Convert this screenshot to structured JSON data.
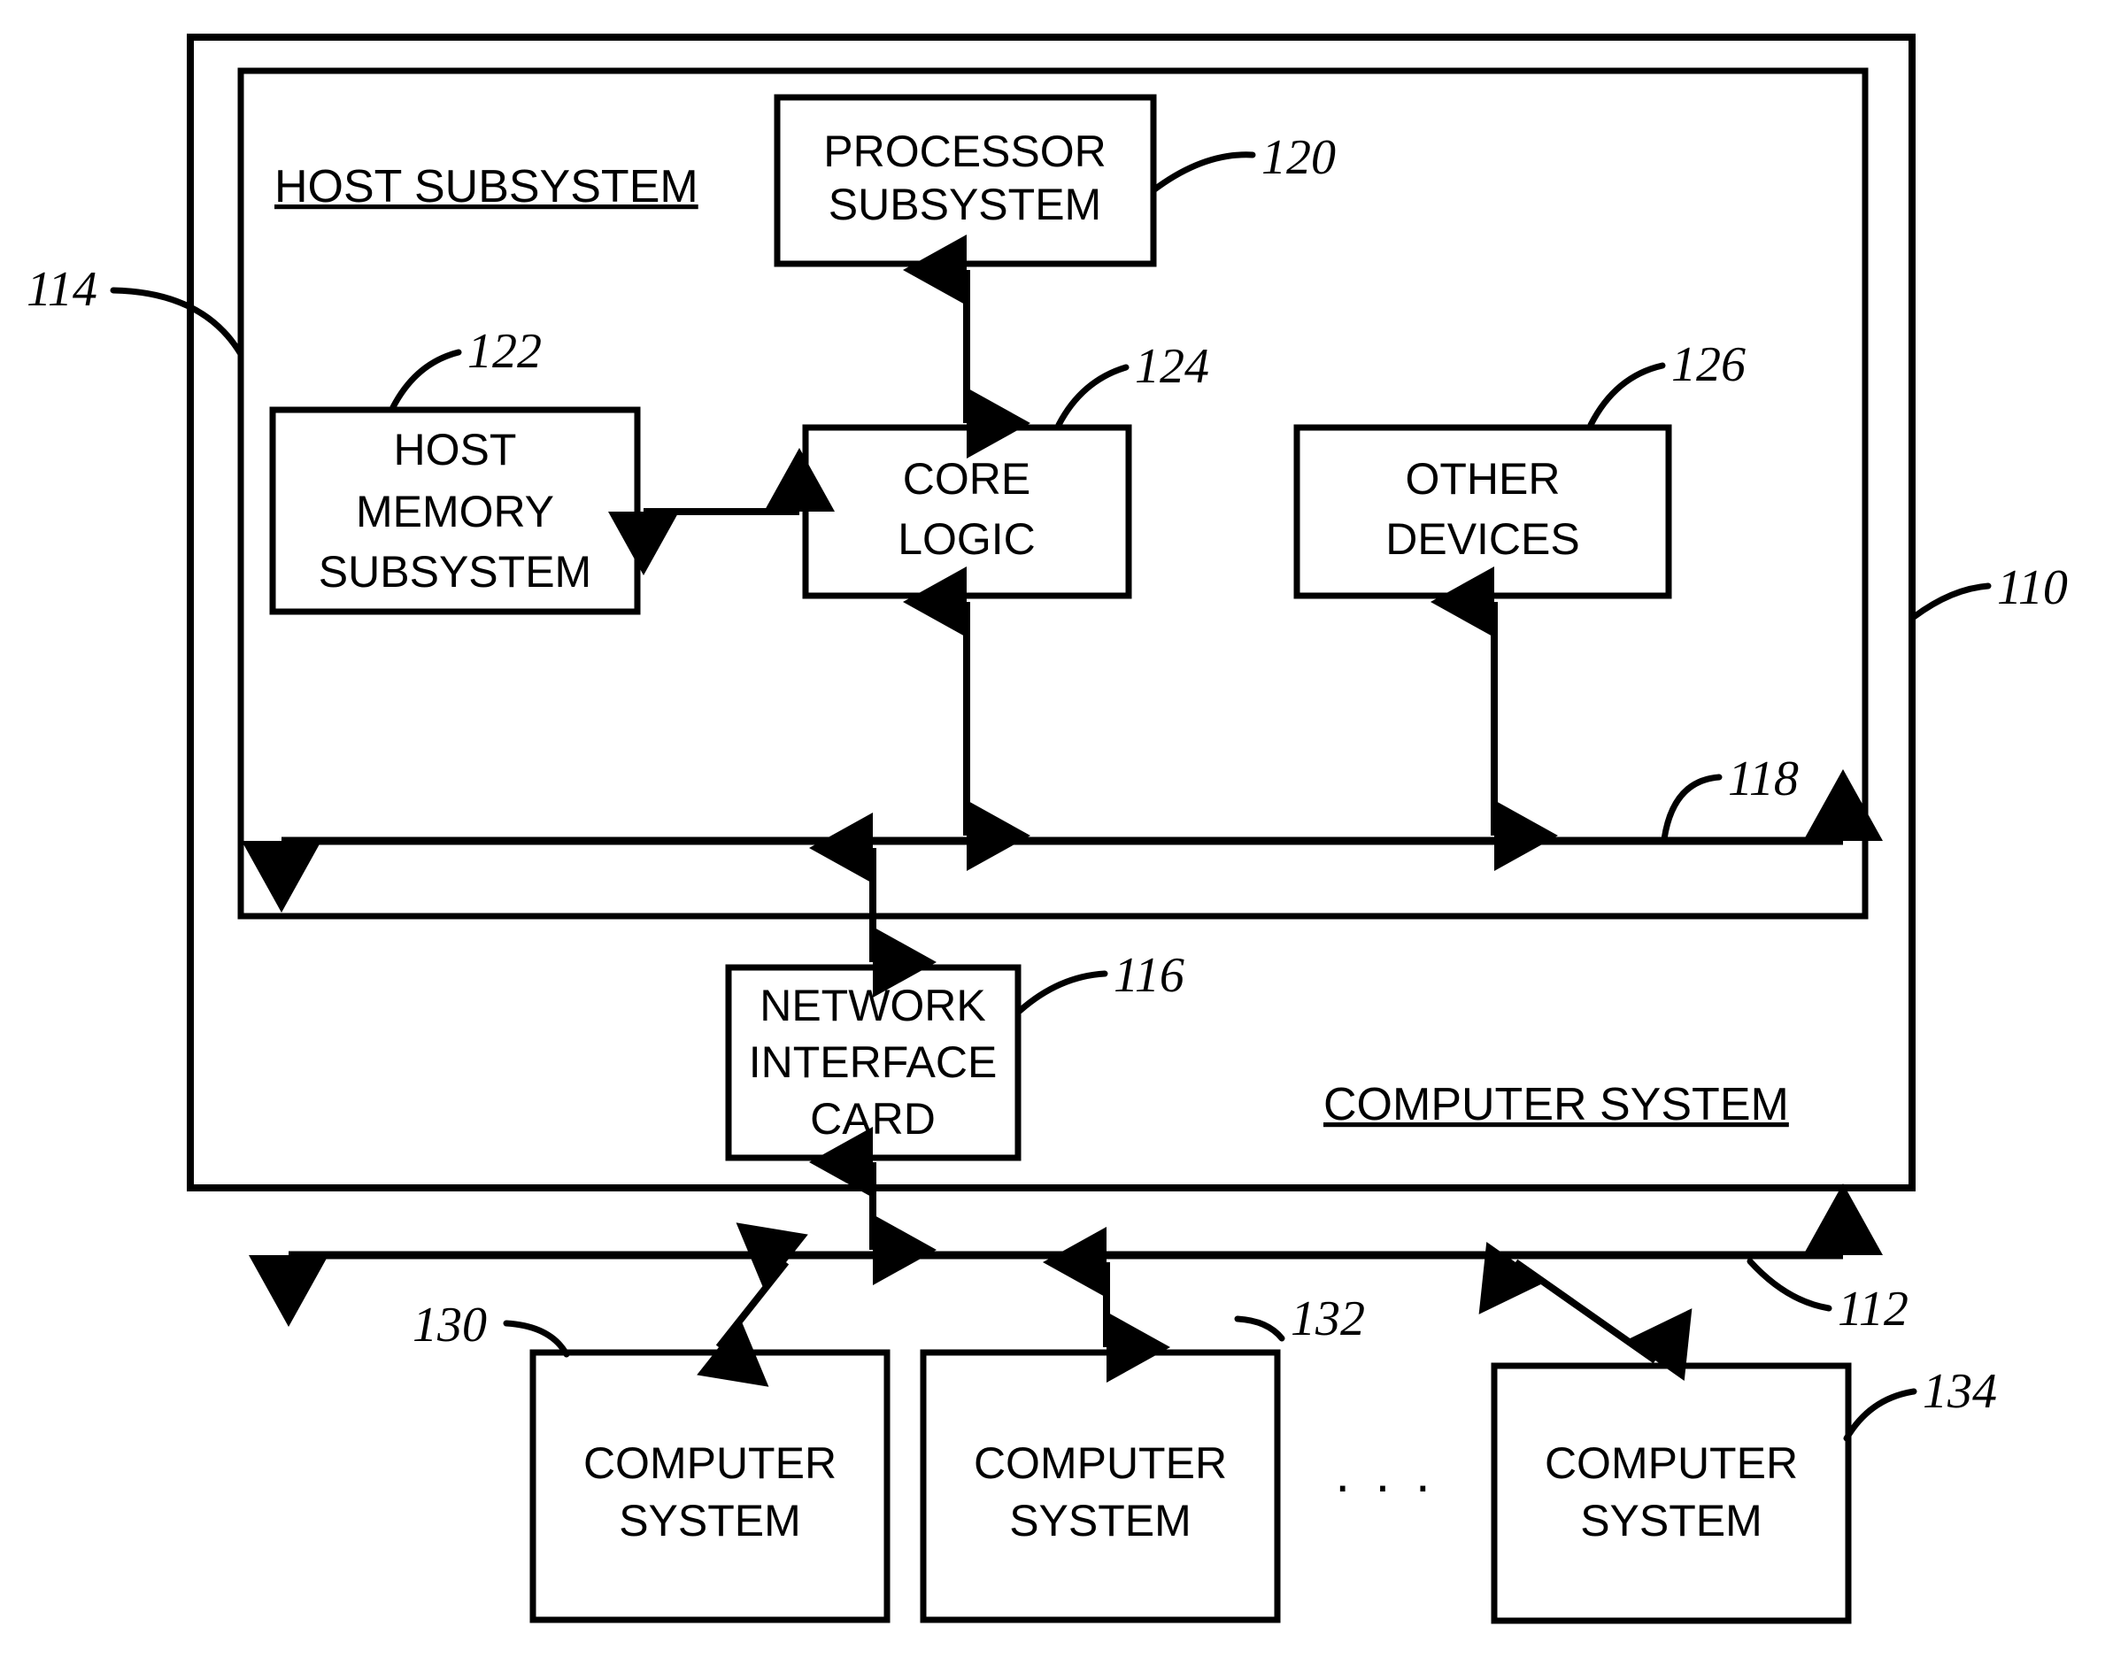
{
  "figure": {
    "type": "patent-block-diagram",
    "title": "Computer system with host subsystem and network interface card"
  },
  "containers": {
    "computer_system": {
      "label": "COMPUTER SYSTEM",
      "ref": "110",
      "underlined": true
    },
    "host_subsystem": {
      "label": "HOST SUBSYSTEM",
      "ref": "114",
      "underlined": true
    }
  },
  "blocks": [
    {
      "id": "processor_subsystem",
      "lines": [
        "PROCESSOR",
        "SUBSYSTEM"
      ],
      "ref": "120"
    },
    {
      "id": "host_memory_subsystem",
      "lines": [
        "HOST",
        "MEMORY",
        "SUBSYSTEM"
      ],
      "ref": "122"
    },
    {
      "id": "core_logic",
      "lines": [
        "CORE",
        "LOGIC"
      ],
      "ref": "124"
    },
    {
      "id": "other_devices",
      "lines": [
        "OTHER",
        "DEVICES"
      ],
      "ref": "126"
    },
    {
      "id": "network_interface_card",
      "lines": [
        "NETWORK",
        "INTERFACE",
        "CARD"
      ],
      "ref": "116"
    },
    {
      "id": "peer_computer_system_1",
      "lines": [
        "COMPUTER",
        "SYSTEM"
      ],
      "ref": "130"
    },
    {
      "id": "peer_computer_system_2",
      "lines": [
        "COMPUTER",
        "SYSTEM"
      ],
      "ref": "132"
    },
    {
      "id": "peer_computer_system_n",
      "lines": [
        "COMPUTER",
        "SYSTEM"
      ],
      "ref": "134"
    }
  ],
  "buses": [
    {
      "id": "host_bus",
      "ref": "118",
      "description": "internal host bus, bidirectional"
    },
    {
      "id": "network",
      "ref": "112",
      "description": "external network, bidirectional"
    }
  ],
  "ellipsis": ". . .",
  "reference_numerals": [
    "110",
    "112",
    "114",
    "116",
    "118",
    "120",
    "122",
    "124",
    "126",
    "130",
    "132",
    "134"
  ],
  "colors": {
    "stroke": "#000000",
    "background": "#ffffff"
  }
}
